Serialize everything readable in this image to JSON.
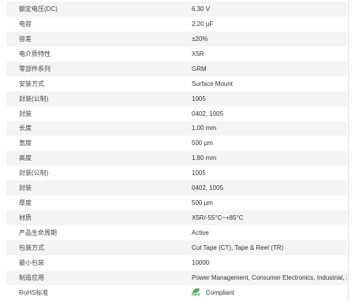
{
  "specs": [
    {
      "label": "额定电压(DC)",
      "value": "6.30 V"
    },
    {
      "label": "电容",
      "value": "2.20 µF"
    },
    {
      "label": "容差",
      "value": "±20%"
    },
    {
      "label": "电介质特性",
      "value": "X5R"
    },
    {
      "label": "零部件系列",
      "value": "GRM"
    },
    {
      "label": "安装方式",
      "value": "Surface Mount"
    },
    {
      "label": "封装(公制)",
      "value": "1005"
    },
    {
      "label": "封装",
      "value": "0402, 1005"
    },
    {
      "label": "长度",
      "value": "1.00 mm"
    },
    {
      "label": "宽度",
      "value": "500 µm"
    },
    {
      "label": "高度",
      "value": "1.80 mm"
    },
    {
      "label": "封装(公制)",
      "value": "1005"
    },
    {
      "label": "封装",
      "value": "0402, 1005"
    },
    {
      "label": "厚度",
      "value": "500 µm"
    },
    {
      "label": "材质",
      "value": "X5R/-55°C~+85°C"
    },
    {
      "label": "产品生命周期",
      "value": "Active"
    },
    {
      "label": "包装方式",
      "value": "Cut Tape (CT), Tape & Reel (TR)"
    },
    {
      "label": "最小包装",
      "value": "10000"
    },
    {
      "label": "制造应用",
      "value": "Power Management, Consumer Electronics, Industrial, 通用..."
    },
    {
      "label": "RoHS标准",
      "value": "Compliant",
      "icon": "rohs-leaf-icon",
      "icon_text": "RoHS"
    }
  ]
}
